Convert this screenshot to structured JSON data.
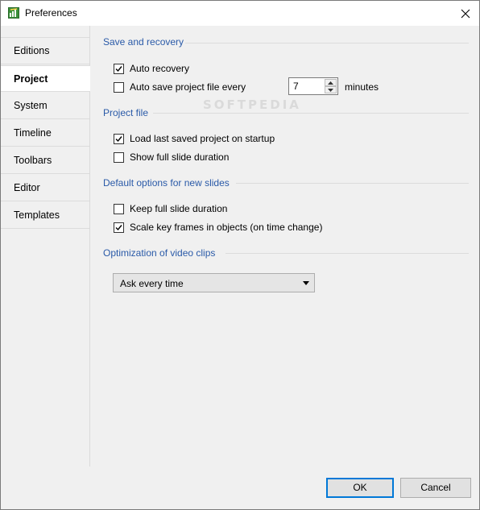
{
  "window": {
    "title": "Preferences"
  },
  "sidebar": {
    "items": [
      {
        "label": "Editions",
        "active": false
      },
      {
        "label": "Project",
        "active": true
      },
      {
        "label": "System",
        "active": false
      },
      {
        "label": "Timeline",
        "active": false
      },
      {
        "label": "Toolbars",
        "active": false
      },
      {
        "label": "Editor",
        "active": false
      },
      {
        "label": "Templates",
        "active": false
      }
    ]
  },
  "sections": {
    "save_recovery": {
      "title": "Save and recovery",
      "auto_recovery": {
        "label": "Auto recovery",
        "checked": true
      },
      "auto_save": {
        "label": "Auto save project file every",
        "checked": false
      },
      "interval_value": "7",
      "interval_unit": "minutes"
    },
    "project_file": {
      "title": "Project file",
      "load_last": {
        "label": "Load last saved project on startup",
        "checked": true
      },
      "show_full": {
        "label": "Show full slide duration",
        "checked": false
      }
    },
    "default_options": {
      "title": "Default options for new slides",
      "keep_full": {
        "label": "Keep full slide duration",
        "checked": false
      },
      "scale_key": {
        "label": "Scale key frames in objects (on time change)",
        "checked": true
      }
    },
    "video_opt": {
      "title": "Optimization of video clips",
      "selected": "Ask every time"
    }
  },
  "footer": {
    "ok_label": "OK",
    "cancel_label": "Cancel"
  },
  "watermark": "SOFTPEDIA",
  "colors": {
    "section_title": "#2a5aa8",
    "primary_border": "#0078d7"
  }
}
